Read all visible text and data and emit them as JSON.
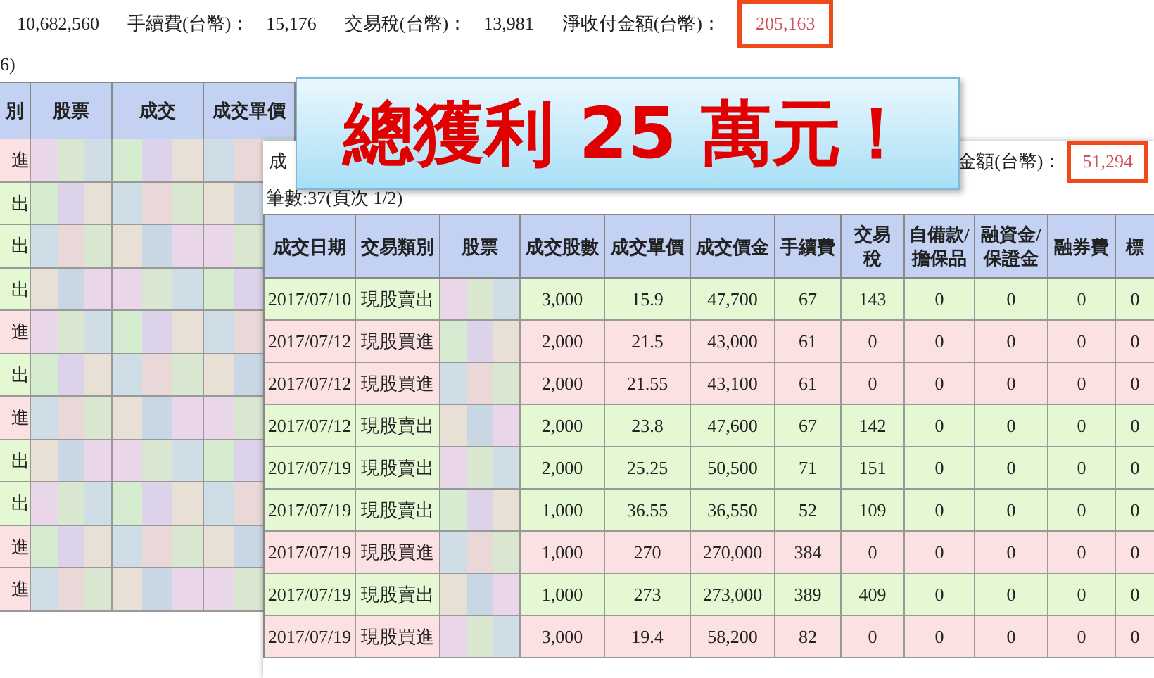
{
  "summary": [
    {
      "value": "10,682,560",
      "highlighted": false
    },
    {
      "label": "手續費(台幣)：",
      "value": "15,176",
      "highlighted": false
    },
    {
      "label": "交易稅(台幣)：",
      "value": "13,981",
      "highlighted": false
    },
    {
      "label": "淨收付金額(台幣)：",
      "value": "205,163",
      "highlighted": true
    }
  ],
  "back_table": {
    "caption": "6)",
    "columns": [
      "別",
      "股票",
      "成交",
      "成交單價"
    ],
    "rows": [
      {
        "kind": "buy",
        "type": "進"
      },
      {
        "kind": "sell",
        "type": "出"
      },
      {
        "kind": "sell",
        "type": "出"
      },
      {
        "kind": "sell",
        "type": "出"
      },
      {
        "kind": "buy",
        "type": "進"
      },
      {
        "kind": "sell",
        "type": "出"
      },
      {
        "kind": "buy",
        "type": "進"
      },
      {
        "kind": "sell",
        "type": "出"
      },
      {
        "kind": "sell",
        "type": "出"
      },
      {
        "kind": "buy",
        "type": "進"
      },
      {
        "kind": "buy",
        "type": "進"
      }
    ]
  },
  "banner": {
    "text": "總獲利 25 萬元！"
  },
  "front_page": {
    "heading": "成",
    "total_label": "金額(台幣)：",
    "total_value": "51,294",
    "record_count": "筆數:37(頁次 1/2)",
    "columns": [
      "成交日期",
      "交易類別",
      "股票",
      "成交股數",
      "成交單價",
      "成交價金",
      "手續費",
      "交易稅",
      "自備款/擔保品",
      "融資金/保證金",
      "融券費",
      "標"
    ],
    "rows": [
      {
        "kind": "sell",
        "cells": [
          "2017/07/10",
          "現股賣出",
          "",
          "3,000",
          "15.9",
          "47,700",
          "67",
          "143",
          "0",
          "0",
          "0",
          "0"
        ]
      },
      {
        "kind": "buy",
        "cells": [
          "2017/07/12",
          "現股買進",
          "",
          "2,000",
          "21.5",
          "43,000",
          "61",
          "0",
          "0",
          "0",
          "0",
          "0"
        ]
      },
      {
        "kind": "buy",
        "cells": [
          "2017/07/12",
          "現股買進",
          "",
          "2,000",
          "21.55",
          "43,100",
          "61",
          "0",
          "0",
          "0",
          "0",
          "0"
        ]
      },
      {
        "kind": "sell",
        "cells": [
          "2017/07/12",
          "現股賣出",
          "",
          "2,000",
          "23.8",
          "47,600",
          "67",
          "142",
          "0",
          "0",
          "0",
          "0"
        ]
      },
      {
        "kind": "sell",
        "cells": [
          "2017/07/19",
          "現股賣出",
          "",
          "2,000",
          "25.25",
          "50,500",
          "71",
          "151",
          "0",
          "0",
          "0",
          "0"
        ]
      },
      {
        "kind": "sell",
        "cells": [
          "2017/07/19",
          "現股賣出",
          "",
          "1,000",
          "36.55",
          "36,550",
          "52",
          "109",
          "0",
          "0",
          "0",
          "0"
        ]
      },
      {
        "kind": "buy",
        "cells": [
          "2017/07/19",
          "現股買進",
          "",
          "1,000",
          "270",
          "270,000",
          "384",
          "0",
          "0",
          "0",
          "0",
          "0"
        ]
      },
      {
        "kind": "sell",
        "cells": [
          "2017/07/19",
          "現股賣出",
          "",
          "1,000",
          "273",
          "273,000",
          "389",
          "409",
          "0",
          "0",
          "0",
          "0"
        ]
      },
      {
        "kind": "buy",
        "cells": [
          "2017/07/19",
          "現股買進",
          "",
          "3,000",
          "19.4",
          "58,200",
          "82",
          "0",
          "0",
          "0",
          "0",
          "0"
        ]
      }
    ]
  }
}
